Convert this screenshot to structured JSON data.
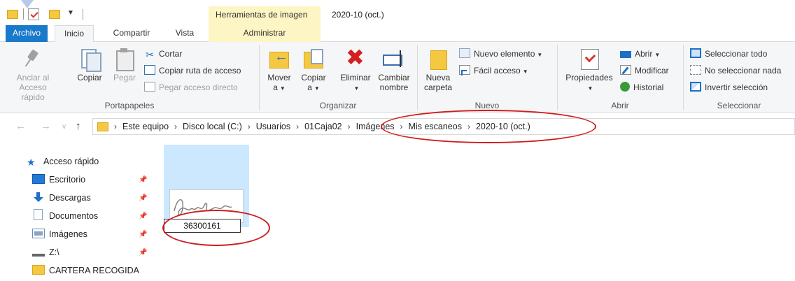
{
  "window": {
    "title": "2020-10 (oct.)",
    "context_tab": "Herramientas de imagen"
  },
  "tabs": [
    {
      "label": "Archivo"
    },
    {
      "label": "Inicio"
    },
    {
      "label": "Compartir"
    },
    {
      "label": "Vista"
    },
    {
      "label": "Administrar"
    }
  ],
  "ribbon": {
    "portapapeles": {
      "anclar": "Anclar al\nAcceso rápido",
      "anclar_line1": "Anclar al",
      "anclar_line2": "Acceso rápido",
      "copiar": "Copiar",
      "pegar": "Pegar",
      "cortar": "Cortar",
      "copiar_ruta": "Copiar ruta de acceso",
      "pegar_acceso": "Pegar acceso directo",
      "label": "Portapapeles"
    },
    "organizar": {
      "mover_line1": "Mover",
      "mover_line2": "a",
      "copiar_line1": "Copiar",
      "copiar_line2": "a",
      "eliminar": "Eliminar",
      "cambiar_line1": "Cambiar",
      "cambiar_line2": "nombre",
      "label": "Organizar"
    },
    "nuevo": {
      "nueva_line1": "Nueva",
      "nueva_line2": "carpeta",
      "nuevo_elemento": "Nuevo elemento",
      "facil_acceso": "Fácil acceso",
      "label": "Nuevo"
    },
    "abrir": {
      "propiedades": "Propiedades",
      "abrir": "Abrir",
      "modificar": "Modificar",
      "historial": "Historial",
      "label": "Abrir"
    },
    "seleccionar": {
      "todo": "Seleccionar todo",
      "nada": "No seleccionar nada",
      "invertir": "Invertir selección",
      "label": "Seleccionar"
    }
  },
  "address": {
    "crumbs": [
      "Este equipo",
      "Disco local (C:)",
      "Usuarios",
      "01Caja02",
      "Imágenes",
      "Mis escaneos",
      "2020-10 (oct.)"
    ]
  },
  "nav_pane": {
    "items": [
      {
        "label": "Acceso rápido",
        "icon": "star-icon"
      },
      {
        "label": "Escritorio",
        "icon": "desktop-icon"
      },
      {
        "label": "Descargas",
        "icon": "download-icon"
      },
      {
        "label": "Documentos",
        "icon": "documents-icon"
      },
      {
        "label": "Imágenes",
        "icon": "pictures-icon"
      },
      {
        "label": "Z:\\",
        "icon": "network-drive-icon"
      },
      {
        "label": "CARTERA RECOGIDA",
        "icon": "folder-icon"
      }
    ]
  },
  "content": {
    "file_rename_value": "36300161"
  },
  "colors": {
    "file_tab": "#1979ca",
    "context_tab": "#fdf5c3",
    "selection": "#cce8ff",
    "annotation": "#cf1e1e"
  }
}
